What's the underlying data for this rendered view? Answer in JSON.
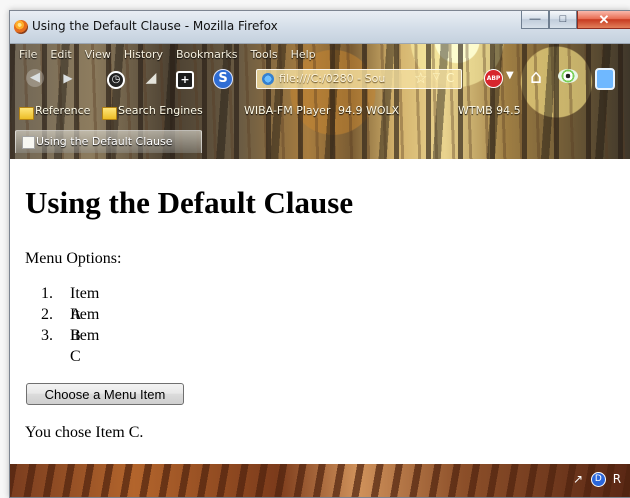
{
  "window": {
    "title": "Using the Default Clause - Mozilla Firefox",
    "controls": {
      "minimize": "—",
      "maximize": "□",
      "close": "✕"
    }
  },
  "menu": {
    "file": "File",
    "edit": "Edit",
    "view": "View",
    "history": "History",
    "bookmarks": "Bookmarks",
    "tools": "Tools",
    "help": "Help"
  },
  "navigation": {
    "url": "file:///C:/0280 - Sou",
    "star": "☆",
    "dropdown": "▽",
    "reload": "C",
    "abp_label": "ABP"
  },
  "bookmarks": [
    {
      "label": "Reference",
      "folder": true
    },
    {
      "label": "Search Engines",
      "folder": true
    },
    {
      "label": "WIBA-FM Player",
      "folder": false
    },
    {
      "label": "94.9 WOLX",
      "folder": false
    },
    {
      "label": "WTMB 94.5",
      "folder": false
    }
  ],
  "tab": {
    "label": "Using the Default Clause"
  },
  "page": {
    "heading": "Using the Default Clause",
    "intro": "Menu Options:",
    "options": [
      {
        "number": "1.",
        "label": "Item A"
      },
      {
        "number": "2.",
        "label": "Item B"
      },
      {
        "number": "3.",
        "label": "Item C"
      }
    ],
    "button_label": "Choose a Menu Item",
    "result": "You chose Item C."
  },
  "status": {
    "left_icon": "↗",
    "blue_icon": "D",
    "right_icon": "R"
  },
  "colors": {
    "title_bar": "#d3dde8",
    "button": "#dcdcdc",
    "close_button": "#c6391f"
  }
}
